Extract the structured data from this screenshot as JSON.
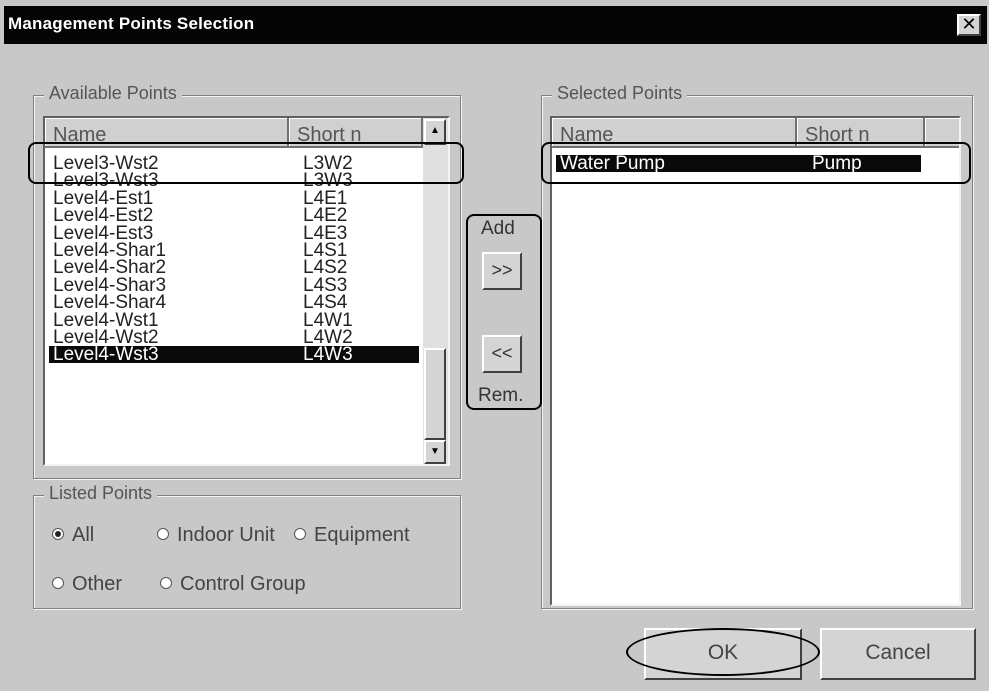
{
  "window": {
    "title": "Management Points Selection",
    "close_label": "✕"
  },
  "available": {
    "group_label": "Available Points",
    "columns": [
      "Name",
      "Short n"
    ],
    "rows": [
      {
        "name": "Level3-Wst2",
        "short": "L3W2"
      },
      {
        "name": "Level3-Wst3",
        "short": "L3W3"
      },
      {
        "name": "Level4-Est1",
        "short": "L4E1"
      },
      {
        "name": "Level4-Est2",
        "short": "L4E2"
      },
      {
        "name": "Level4-Est3",
        "short": "L4E3"
      },
      {
        "name": "Level4-Shar1",
        "short": "L4S1"
      },
      {
        "name": "Level4-Shar2",
        "short": "L4S2"
      },
      {
        "name": "Level4-Shar3",
        "short": "L4S3"
      },
      {
        "name": "Level4-Shar4",
        "short": "L4S4"
      },
      {
        "name": "Level4-Wst1",
        "short": "L4W1"
      },
      {
        "name": "Level4-Wst2",
        "short": "L4W2"
      },
      {
        "name": "Level4-Wst3",
        "short": "L4W3"
      }
    ],
    "selected_row": "Level4-Wst3",
    "scroll_up_icon": "▲",
    "scroll_down_icon": "▼"
  },
  "transfer": {
    "add_label": "Add",
    "add_button": ">>",
    "remove_button": "<<",
    "remove_label": "Rem."
  },
  "selected": {
    "group_label": "Selected Points",
    "columns": [
      "Name",
      "Short n"
    ],
    "rows": [
      {
        "name": "Water Pump",
        "short": "Pump"
      }
    ],
    "selected_row": "Water Pump"
  },
  "listed_points": {
    "group_label": "Listed Points",
    "options": [
      "All",
      "Indoor Unit",
      "Equipment",
      "Other",
      "Control Group"
    ],
    "selected_option": "All"
  },
  "buttons": {
    "ok": "OK",
    "cancel": "Cancel"
  },
  "colors": {
    "titlebar": "#050505",
    "selection": "#0a0a0a",
    "dialog_bg": "#c8c8c8"
  }
}
